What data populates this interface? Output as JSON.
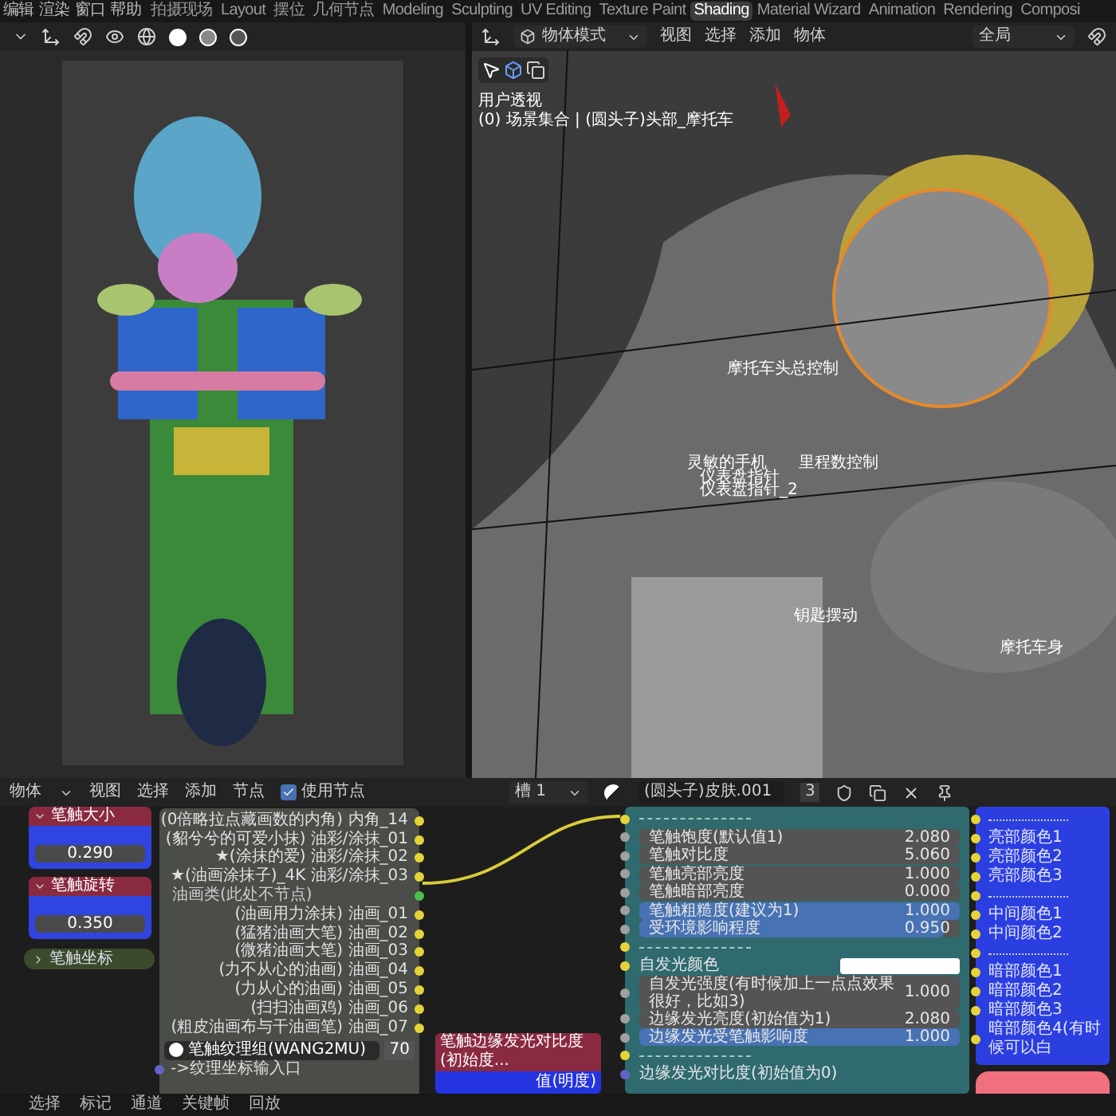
{
  "top_menu": [
    "编辑",
    "渲染",
    "窗口",
    "帮助"
  ],
  "workspaces": [
    {
      "label": "拍摄现场",
      "selected": false
    },
    {
      "label": "Layout",
      "selected": false
    },
    {
      "label": "摆位",
      "selected": false
    },
    {
      "label": "几何节点",
      "selected": false
    },
    {
      "label": "Modeling",
      "selected": false
    },
    {
      "label": "Sculpting",
      "selected": false
    },
    {
      "label": "UV Editing",
      "selected": false
    },
    {
      "label": "Texture Paint",
      "selected": false
    },
    {
      "label": "Shading",
      "selected": true
    },
    {
      "label": "Material Wizard",
      "selected": false
    },
    {
      "label": "Animation",
      "selected": false
    },
    {
      "label": "Rendering",
      "selected": false
    },
    {
      "label": "Composi",
      "selected": false
    }
  ],
  "viewport": {
    "mode": "物体模式",
    "menus": [
      "视图",
      "选择",
      "添加",
      "物体"
    ],
    "orientation": "全局",
    "view_name": "用户透视",
    "collection_path": "(0) 场景集合 | (圆头子)头部_摩托车",
    "labels": [
      "摩托车头总控制",
      "灵敏的手机",
      "仪表盘指针",
      "仪表盘指针_2",
      "里程数控制",
      "钥匙摆动",
      "摩托车身"
    ]
  },
  "node_editor": {
    "object_type": "物体",
    "menus": [
      "视图",
      "选择",
      "添加",
      "节点"
    ],
    "use_nodes": {
      "label": "使用节点",
      "checked": true
    },
    "slot": "槽 1",
    "material": "(圆头子)皮肤.001",
    "users": "3",
    "value_nodes": [
      {
        "title": "笔触大小",
        "value": "0.290"
      },
      {
        "title": "笔触旋转",
        "value": "0.350"
      }
    ],
    "coord_node": {
      "title": "笔触坐标",
      "expanded": false
    },
    "texture_node": {
      "outputs": [
        {
          "kind": "output",
          "label": "(0倍略拉点藏画数的内角) 内角_14"
        },
        {
          "kind": "output",
          "label": "(貂兮兮的可爱小抹) 油彩/涂抹_01"
        },
        {
          "kind": "output",
          "label": "★(涂抹的爱) 油彩/涂抹_02"
        },
        {
          "kind": "output",
          "label": "★(油画涂抹子)_4K 油彩/涂抹_03"
        },
        {
          "kind": "group",
          "label": "油画类(此处不节点)"
        },
        {
          "kind": "output",
          "label": "(油画用力涂抹) 油画_01"
        },
        {
          "kind": "output",
          "label": "(猛猪油画大笔) 油画_02"
        },
        {
          "kind": "output",
          "label": "(微猪油画大笔) 油画_03"
        },
        {
          "kind": "output",
          "label": "(力不从心的油画) 油画_04"
        },
        {
          "kind": "output",
          "label": "(力从心的油画) 油画_05"
        },
        {
          "kind": "output",
          "label": "(扫扫油画鸡) 油画_06"
        },
        {
          "kind": "output",
          "label": "(粗皮油画布与干油画笔) 油画_07"
        }
      ],
      "texture": "笔触纹理组(WANG2MU)",
      "texture_users": "70",
      "input": "->纹理坐标输入口"
    },
    "settings_node": {
      "rows": [
        {
          "kind": "separator"
        },
        {
          "kind": "number",
          "label": "笔触饱度(默认值1)",
          "value": "2.080"
        },
        {
          "kind": "number",
          "label": "笔触对比度",
          "value": "5.060"
        },
        {
          "kind": "number",
          "label": "笔触亮部亮度",
          "value": "1.000"
        },
        {
          "kind": "number",
          "label": "笔触暗部亮度",
          "value": "0.000"
        },
        {
          "kind": "slider",
          "label": "笔触粗糙度(建议为1)",
          "value": "1.000",
          "level": 1
        },
        {
          "kind": "slider",
          "label": "受环境影响程度",
          "value": "0.950",
          "level": 0.95
        },
        {
          "kind": "separator"
        },
        {
          "kind": "color",
          "label": "自发光颜色",
          "color": "#ffffff"
        },
        {
          "kind": "number",
          "label": "自发光强度(有时候加上一点点效果很好，比如3)",
          "value": "1.000"
        },
        {
          "kind": "number",
          "label": "边缘发光亮度(初始值为1)",
          "value": "2.080"
        },
        {
          "kind": "slider",
          "label": "边缘发光受笔触影响度",
          "value": "1.000",
          "level": 1
        },
        {
          "kind": "separator"
        },
        {
          "kind": "input",
          "label": "边缘发光对比度(初始值为0)"
        }
      ]
    },
    "color_node": {
      "rows": [
        {
          "kind": "separator"
        },
        {
          "kind": "input",
          "label": "亮部颜色1"
        },
        {
          "kind": "input",
          "label": "亮部颜色2"
        },
        {
          "kind": "input",
          "label": "亮部颜色3"
        },
        {
          "kind": "separator"
        },
        {
          "kind": "input",
          "label": "中间颜色1"
        },
        {
          "kind": "input",
          "label": "中间颜色2"
        },
        {
          "kind": "separator"
        },
        {
          "kind": "input",
          "label": "暗部颜色1"
        },
        {
          "kind": "input",
          "label": "暗部颜色2"
        },
        {
          "kind": "input",
          "label": "暗部颜色3"
        },
        {
          "kind": "input",
          "label": "暗部颜色4(有时候可以白"
        }
      ]
    },
    "contrast_node": {
      "title": "笔触边缘发光对比度(初始度...",
      "output": "值(明度)"
    }
  },
  "status_bar": [
    "选择",
    "标记",
    "通道",
    "关键帧",
    "回放"
  ]
}
